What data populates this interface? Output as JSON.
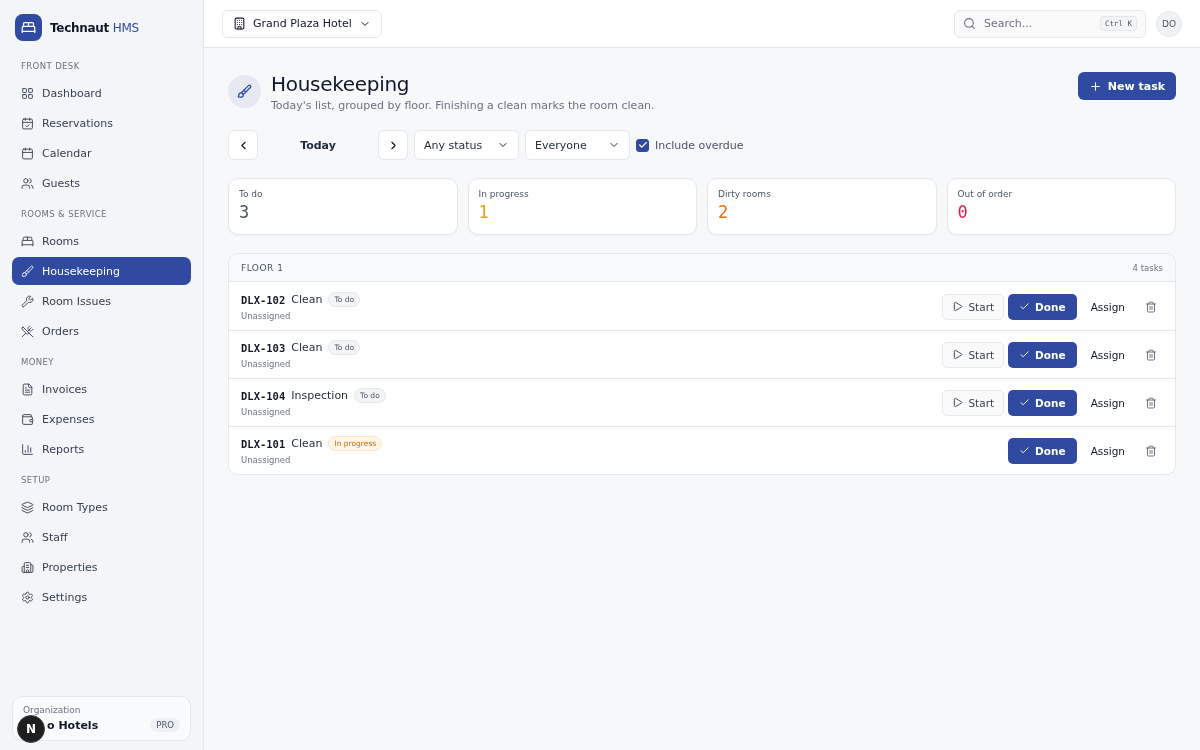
{
  "brand": {
    "name": "Technaut",
    "suffix": "HMS"
  },
  "sidebar": {
    "sections": [
      {
        "title": "FRONT DESK",
        "items": [
          {
            "label": "Dashboard",
            "selected": false
          },
          {
            "label": "Reservations",
            "selected": false
          },
          {
            "label": "Calendar",
            "selected": false
          },
          {
            "label": "Guests",
            "selected": false
          }
        ]
      },
      {
        "title": "ROOMS & SERVICE",
        "items": [
          {
            "label": "Rooms",
            "selected": false
          },
          {
            "label": "Housekeeping",
            "selected": true
          },
          {
            "label": "Room Issues",
            "selected": false
          },
          {
            "label": "Orders",
            "selected": false
          }
        ]
      },
      {
        "title": "MONEY",
        "items": [
          {
            "label": "Invoices",
            "selected": false
          },
          {
            "label": "Expenses",
            "selected": false
          },
          {
            "label": "Reports",
            "selected": false
          }
        ]
      },
      {
        "title": "SETUP",
        "items": [
          {
            "label": "Room Types",
            "selected": false
          },
          {
            "label": "Staff",
            "selected": false
          },
          {
            "label": "Properties",
            "selected": false
          },
          {
            "label": "Settings",
            "selected": false
          }
        ]
      }
    ],
    "org": {
      "label": "Organization",
      "name": "o Hotels",
      "badge": "PRO",
      "overlay_letter": "N"
    }
  },
  "topbar": {
    "property": "Grand Plaza Hotel",
    "search": {
      "placeholder": "Search...",
      "shortcut": "Ctrl K"
    },
    "avatar": "DO"
  },
  "page": {
    "title": "Housekeeping",
    "subtitle": "Today's list, grouped by floor. Finishing a clean marks the room clean.",
    "new_button": "New task"
  },
  "filters": {
    "date": "Today",
    "status": "Any status",
    "assignee": "Everyone",
    "overdue": {
      "label": "Include overdue",
      "checked": true
    }
  },
  "stats": [
    {
      "label": "To do",
      "value": "3",
      "color": "#4b5563"
    },
    {
      "label": "In progress",
      "value": "1",
      "color": "#f59e0b"
    },
    {
      "label": "Dirty rooms",
      "value": "2",
      "color": "#ea6a0c"
    },
    {
      "label": "Out of order",
      "value": "0",
      "color": "#e11d48"
    }
  ],
  "groups": [
    {
      "title": "FLOOR 1",
      "count": "4 tasks",
      "tasks": [
        {
          "room": "DLX-102",
          "type": "Clean",
          "status": {
            "label": "To do",
            "kind": "todo"
          },
          "assignee": "Unassigned",
          "start": "Start",
          "done": "Done",
          "assign": "Assign"
        },
        {
          "room": "DLX-103",
          "type": "Clean",
          "status": {
            "label": "To do",
            "kind": "todo"
          },
          "assignee": "Unassigned",
          "start": "Start",
          "done": "Done",
          "assign": "Assign"
        },
        {
          "room": "DLX-104",
          "type": "Inspection",
          "status": {
            "label": "To do",
            "kind": "todo"
          },
          "assignee": "Unassigned",
          "start": "Start",
          "done": "Done",
          "assign": "Assign"
        },
        {
          "room": "DLX-101",
          "type": "Clean",
          "status": {
            "label": "In progress",
            "kind": "progress"
          },
          "assignee": "Unassigned",
          "done": "Done",
          "assign": "Assign"
        }
      ]
    }
  ]
}
